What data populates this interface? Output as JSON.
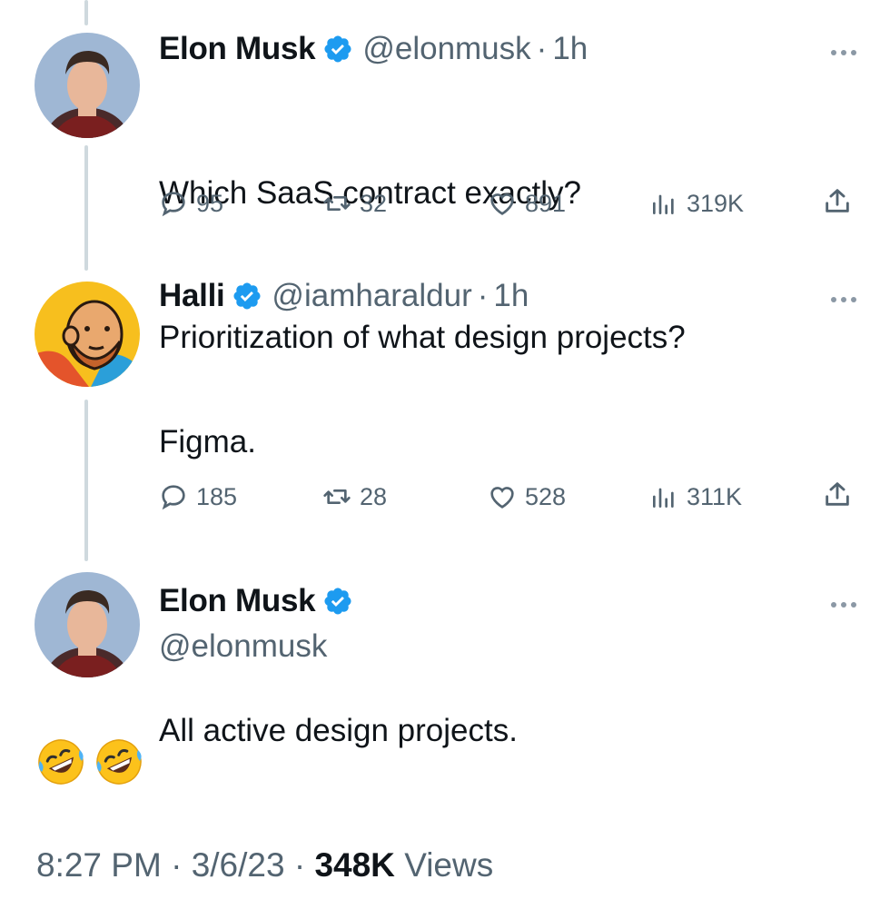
{
  "tweets": [
    {
      "name": "Elon Musk",
      "handle": "@elonmusk",
      "separator": "·",
      "time": "1h",
      "lines": [
        "Which SaaS contract exactly?",
        "Prioritization of what design projects?"
      ],
      "replies": "95",
      "retweets": "32",
      "likes": "891",
      "views": "319K"
    },
    {
      "name": "Halli",
      "handle": "@iamharaldur",
      "separator": "·",
      "time": "1h",
      "lines": [
        "Figma.",
        "",
        "All active design projects."
      ],
      "replies": "185",
      "retweets": "28",
      "likes": "528",
      "views": "311K"
    }
  ],
  "main_tweet": {
    "name": "Elon Musk",
    "handle": "@elonmusk",
    "emojis": [
      "🤣",
      "🤣"
    ],
    "time": "8:27 PM",
    "separator": "·",
    "date": "3/6/23",
    "views_count": "348K",
    "views_label": "Views"
  },
  "icons": {
    "verified": "verified-badge-icon",
    "reply": "reply-icon",
    "retweet": "retweet-icon",
    "like": "heart-icon",
    "views": "analytics-icon",
    "share": "share-icon",
    "more": "more-icon"
  },
  "colors": {
    "verified": "#1d9bf0",
    "secondary_text": "#536471",
    "primary_text": "#0f1419",
    "thread_line": "#cfd9de"
  }
}
